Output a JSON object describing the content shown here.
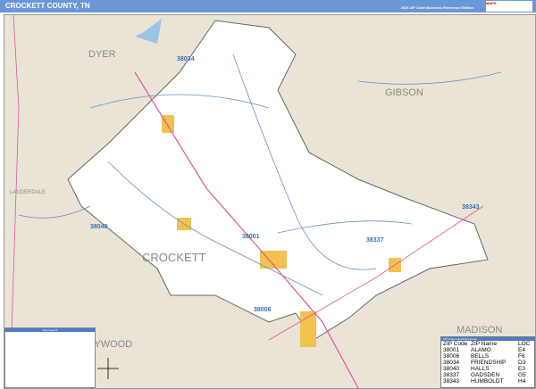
{
  "header": {
    "title": "CROCKETT COUNTY, TN",
    "edition": "2026 ZIP Code Business Reference Edition",
    "logo": "MAPS"
  },
  "map": {
    "county_label": "CROCKETT",
    "neighbors": [
      "DYER",
      "GIBSON",
      "LAUDERDALE",
      "HAYWOOD",
      "MADISON"
    ],
    "zip_labels": [
      "38034",
      "38040",
      "38001",
      "38337",
      "38006",
      "38343"
    ]
  },
  "legend": {
    "title": "Map Legend"
  },
  "zip_table": {
    "title": "ZIP Code Index/Grid Locator",
    "headers": [
      "ZIP Code",
      "ZIP Name",
      "LOC"
    ],
    "rows": [
      [
        "38001",
        "ALAMO",
        "E4"
      ],
      [
        "38006",
        "BELLS",
        "F6"
      ],
      [
        "38034",
        "FRIENDSHIP",
        "D3"
      ],
      [
        "38040",
        "HALLS",
        "E3"
      ],
      [
        "38337",
        "GADSDEN",
        "G5"
      ],
      [
        "38343",
        "HUMBOLDT",
        "H4"
      ]
    ]
  }
}
